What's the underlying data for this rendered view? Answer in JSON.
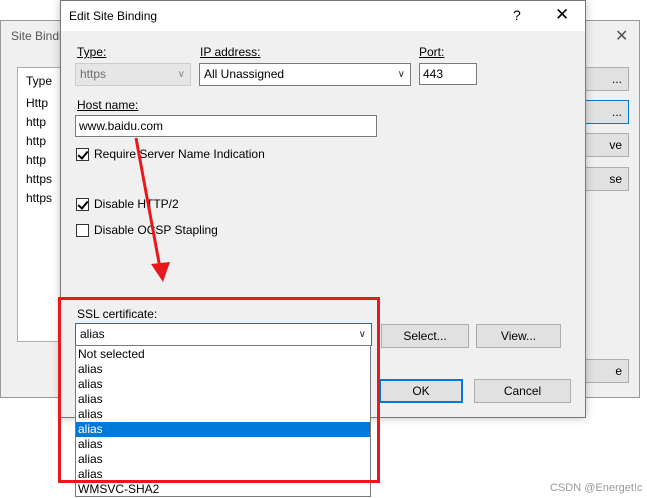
{
  "background_dialog": {
    "title": "Site Bindi",
    "close_glyph": "✕",
    "list_header": "Type",
    "list_rows": [
      "Http",
      "http",
      "http",
      "http",
      "https",
      "https"
    ],
    "buttons": [
      "...",
      "...",
      "ve",
      "se",
      "e"
    ]
  },
  "dialog": {
    "title": "Edit Site Binding",
    "help_glyph": "?",
    "close_glyph": "✕",
    "type_label": "Type:",
    "type_value": "https",
    "ip_label": "IP address:",
    "ip_value": "All Unassigned",
    "port_label": "Port:",
    "port_value": "443",
    "host_label": "Host name:",
    "host_value": "www.baidu.com",
    "sni_label": "Require Server Name Indication",
    "http2_label": "Disable HTTP/2",
    "ocsp_label": "Disable OCSP Stapling",
    "ssl_label": "SSL certificate:",
    "ssl_value": "alias",
    "select_button": "Select...",
    "view_button": "View...",
    "ok_button": "OK",
    "cancel_button": "Cancel"
  },
  "dropdown": {
    "options": [
      "Not selected",
      "alias",
      "alias",
      "alias",
      "alias",
      "alias",
      "alias",
      "alias",
      "alias",
      "WMSVC-SHA2"
    ],
    "selected_index": 5
  },
  "watermark": "CSDN @Energet!c",
  "colors": {
    "highlight": "#0078d7",
    "annotation": "#e8191c"
  }
}
